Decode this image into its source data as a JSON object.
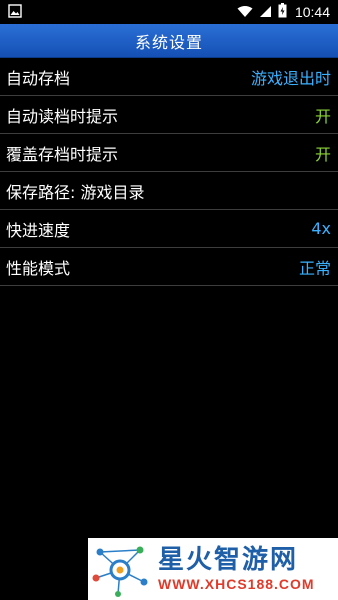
{
  "status_bar": {
    "time": "10:44",
    "icons": [
      "image-icon",
      "wifi-icon",
      "signal-icon",
      "battery-icon"
    ]
  },
  "header": {
    "title": "系统设置"
  },
  "settings": [
    {
      "label": "自动存档",
      "value": "游戏退出时",
      "value_color": "#3ab1ff"
    },
    {
      "label": "自动读档时提示",
      "value": "开",
      "value_color": "#8cd43a"
    },
    {
      "label": "覆盖存档时提示",
      "value": "开",
      "value_color": "#8cd43a"
    },
    {
      "label": "保存路径: 游戏目录",
      "value": ""
    },
    {
      "label": "快进速度",
      "value": "4x",
      "value_color": "#3ab1ff"
    },
    {
      "label": "性能模式",
      "value": "正常",
      "value_color": "#3ab1ff"
    }
  ],
  "watermark": {
    "name": "星火智游网",
    "url": "WWW.XHCS188.COM"
  },
  "colors": {
    "title_bar": "#1f5fc4",
    "value_blue": "#3ab1ff",
    "value_green": "#8cd43a",
    "divider": "#3d3d3d"
  }
}
